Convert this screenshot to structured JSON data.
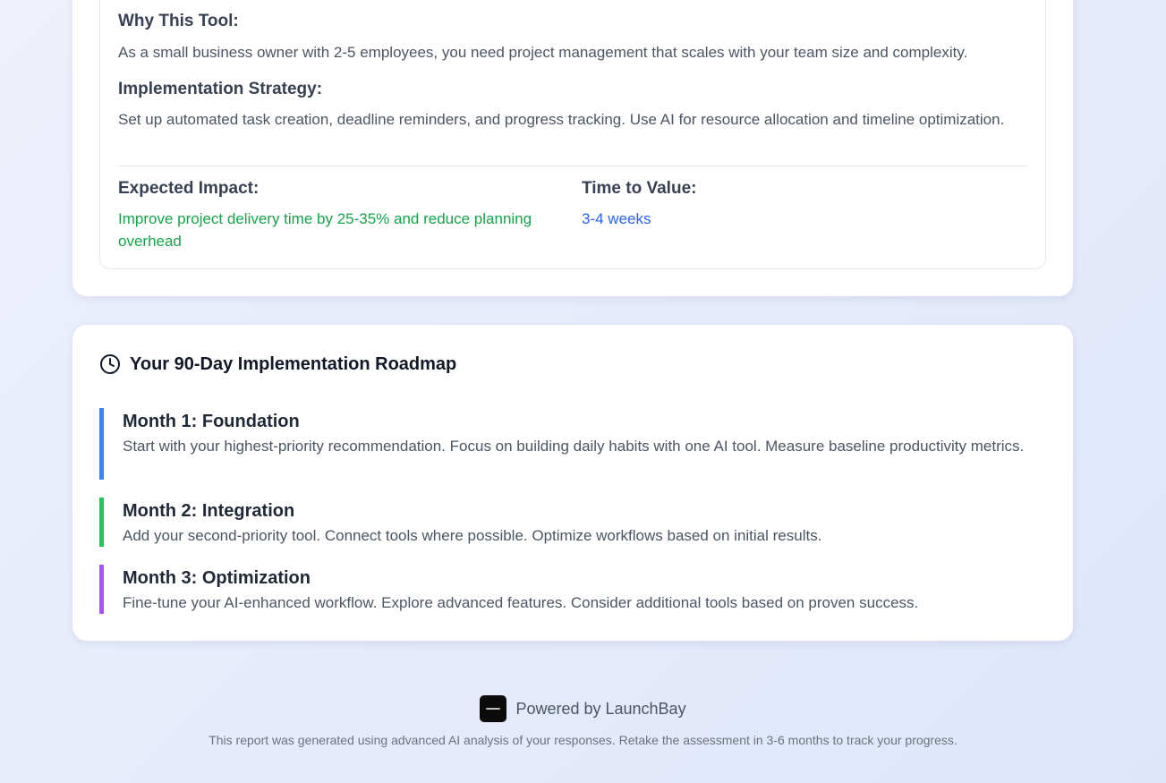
{
  "tool_card": {
    "why_label": "Why This Tool:",
    "why_text": "As a small business owner with 2-5 employees, you need project management that scales with your team size and complexity.",
    "strategy_label": "Implementation Strategy:",
    "strategy_text": "Set up automated task creation, deadline reminders, and progress tracking. Use AI for resource allocation and timeline optimization.",
    "impact_label": "Expected Impact:",
    "impact_text": "Improve project delivery time by 25-35% and reduce planning overhead",
    "time_label": "Time to Value:",
    "time_text": "3-4 weeks",
    "impact_color": "#16a34a",
    "time_color": "#2563eb"
  },
  "roadmap": {
    "icon": "clock-icon",
    "title": "Your 90-Day Implementation Roadmap",
    "months": [
      {
        "title": "Month 1: Foundation",
        "description": "Start with your highest-priority recommendation. Focus on building daily habits with one AI tool. Measure baseline productivity metrics.",
        "color": "#3b82f6"
      },
      {
        "title": "Month 2: Integration",
        "description": "Add your second-priority tool. Connect tools where possible. Optimize workflows based on initial results.",
        "color": "#22c55e"
      },
      {
        "title": "Month 3: Optimization",
        "description": "Fine-tune your AI-enhanced workflow. Explore advanced features. Consider additional tools based on proven success.",
        "color": "#a855f7"
      }
    ]
  },
  "footer": {
    "logo_icon": "launchbay-logo-icon",
    "powered_by": "Powered by LaunchBay",
    "note": "This report was generated using advanced AI analysis of your responses. Retake the assessment in 3-6 months to track your progress."
  }
}
